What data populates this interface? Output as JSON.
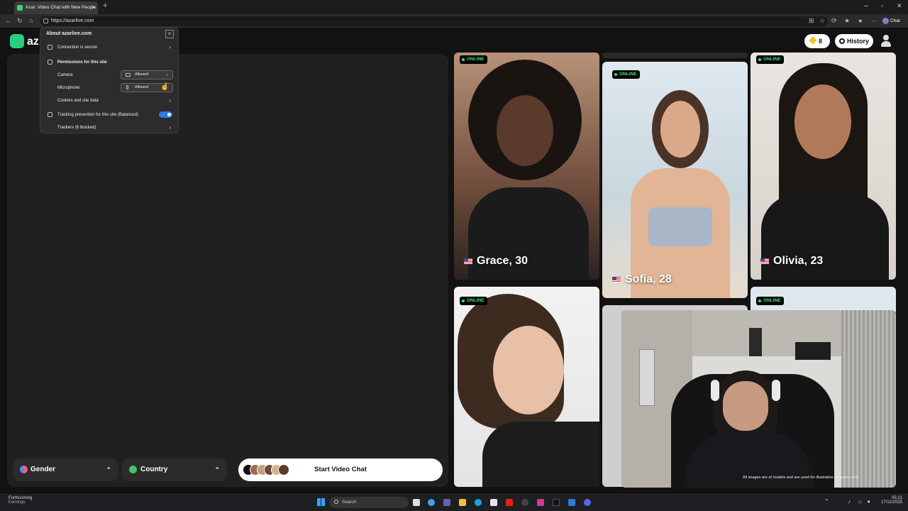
{
  "browser": {
    "tab_title": "Azar: Video Chat with New People",
    "tab_close": "×",
    "new_tab": "+",
    "url": "https://azarlive.com",
    "chat_label": "Chat",
    "window_min": "─",
    "window_max": "▫",
    "window_close": "✕"
  },
  "site_popup": {
    "title": "About azarlive.com",
    "close": "×",
    "connection": "Connection is secure",
    "permissions_heading": "Permissions for this site",
    "camera_label": "Camera",
    "camera_value": "Allowed",
    "microphone_label": "Microphone",
    "microphone_value": "Allowed",
    "cookies": "Cookies and site data",
    "tracking": "Tracking prevention for this site (Balanced)",
    "tracking_enabled": true,
    "trackers": "Trackers (6 blocked)"
  },
  "header": {
    "logo_text": "az",
    "coins": "8",
    "history_label": "History"
  },
  "filters": {
    "gender_label": "Gender",
    "country_label": "Country",
    "start_label": "Start Video Chat"
  },
  "cards": [
    {
      "name": "Grace, 30",
      "status": "ONLINE"
    },
    {
      "name": "Sofia, 28",
      "status": "ONLINE"
    },
    {
      "name": "Olivia, 23",
      "status": "ONLINE"
    },
    {
      "name": "",
      "status": "ONLINE"
    },
    {
      "name": "",
      "status": "ONLINE"
    }
  ],
  "webcam": {
    "disclaimer": "All images are of models and are used for illustrative purposes only."
  },
  "taskbar": {
    "weather_title": "Forthcoming",
    "weather_sub": "Earnings",
    "search_placeholder": "Search",
    "time": "05:21",
    "date": "17/12/2025"
  },
  "colors": {
    "brand": "#27d07e",
    "online": "#3ee07f",
    "toggle": "#2f7be0"
  }
}
